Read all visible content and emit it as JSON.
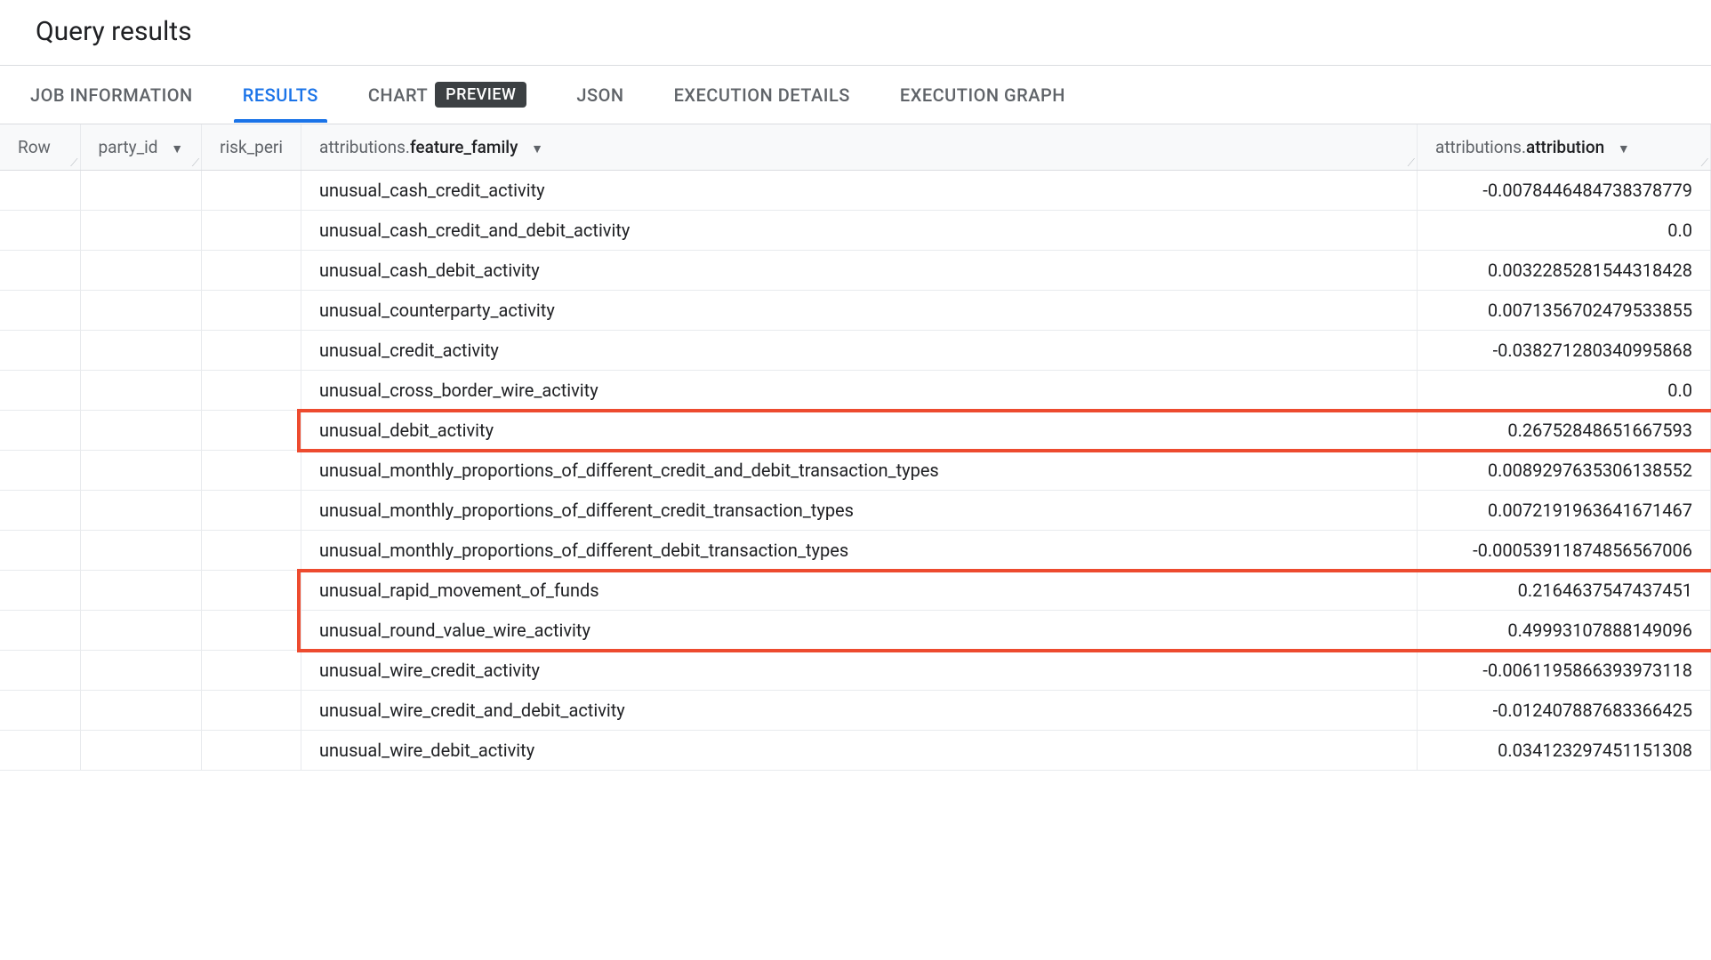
{
  "page_title": "Query results",
  "tabs": [
    {
      "label": "JOB INFORMATION",
      "active": false
    },
    {
      "label": "RESULTS",
      "active": true
    },
    {
      "label": "CHART",
      "active": false,
      "badge": "PREVIEW"
    },
    {
      "label": "JSON",
      "active": false
    },
    {
      "label": "EXECUTION DETAILS",
      "active": false
    },
    {
      "label": "EXECUTION GRAPH",
      "active": false
    }
  ],
  "columns": {
    "row": "Row",
    "party_id": "party_id",
    "risk_peri": "risk_peri",
    "feature_family_prefix": "attributions.",
    "feature_family_bold": "feature_family",
    "attribution_prefix": "attributions.",
    "attribution_bold": "attribution"
  },
  "rows": [
    {
      "feature_family": "unusual_cash_credit_activity",
      "attribution": "-0.0078446484738378779",
      "highlight": false
    },
    {
      "feature_family": "unusual_cash_credit_and_debit_activity",
      "attribution": "0.0",
      "highlight": false
    },
    {
      "feature_family": "unusual_cash_debit_activity",
      "attribution": "0.0032285281544318428",
      "highlight": false
    },
    {
      "feature_family": "unusual_counterparty_activity",
      "attribution": "0.0071356702479533855",
      "highlight": false
    },
    {
      "feature_family": "unusual_credit_activity",
      "attribution": "-0.038271280340995868",
      "highlight": false
    },
    {
      "feature_family": "unusual_cross_border_wire_activity",
      "attribution": "0.0",
      "highlight": false
    },
    {
      "feature_family": "unusual_debit_activity",
      "attribution": "0.26752848651667593",
      "highlight": true
    },
    {
      "feature_family": "unusual_monthly_proportions_of_different_credit_and_debit_transaction_types",
      "attribution": "0.0089297635306138552",
      "highlight": false
    },
    {
      "feature_family": "unusual_monthly_proportions_of_different_credit_transaction_types",
      "attribution": "0.0072191963641671467",
      "highlight": false
    },
    {
      "feature_family": "unusual_monthly_proportions_of_different_debit_transaction_types",
      "attribution": "-0.00053911874856567006",
      "highlight": false
    },
    {
      "feature_family": "unusual_rapid_movement_of_funds",
      "attribution": "0.2164637547437451",
      "highlight": true
    },
    {
      "feature_family": "unusual_round_value_wire_activity",
      "attribution": "0.49993107888149096",
      "highlight": true
    },
    {
      "feature_family": "unusual_wire_credit_activity",
      "attribution": "-0.0061195866393973118",
      "highlight": false
    },
    {
      "feature_family": "unusual_wire_credit_and_debit_activity",
      "attribution": "-0.012407887683366425",
      "highlight": false
    },
    {
      "feature_family": "unusual_wire_debit_activity",
      "attribution": "0.034123297451151308",
      "highlight": false
    }
  ]
}
